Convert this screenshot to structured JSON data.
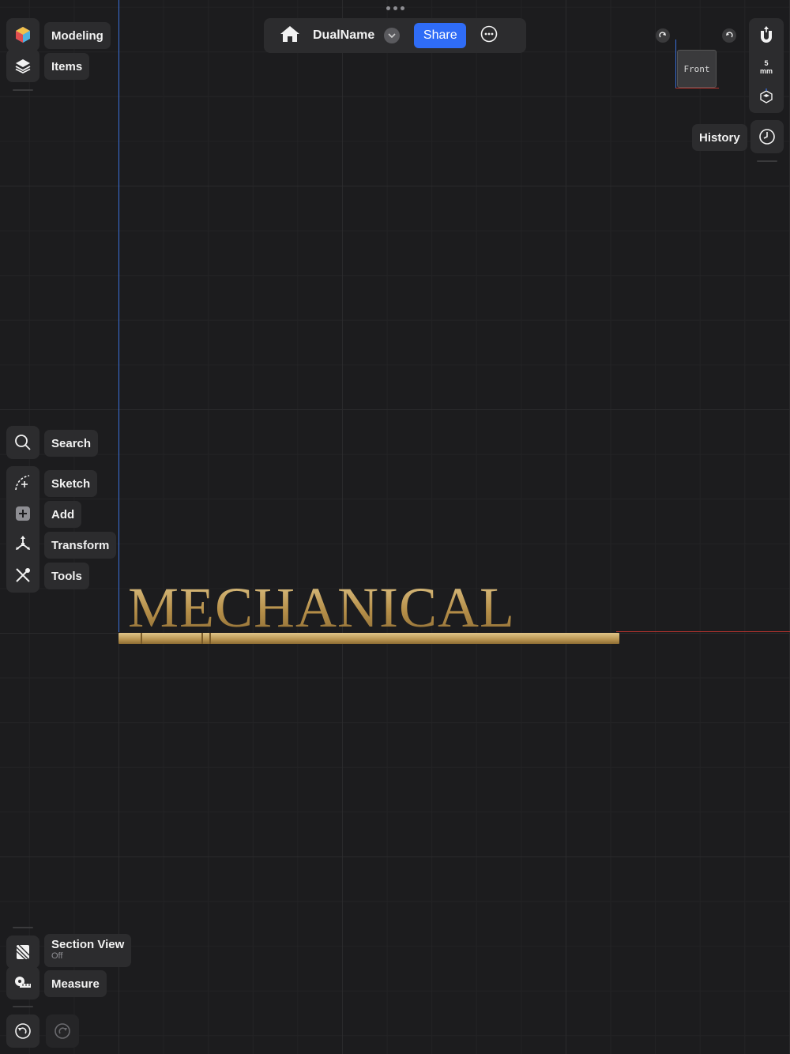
{
  "app": {
    "document_name": "DualName",
    "share_label": "Share"
  },
  "left_top": {
    "modeling_label": "Modeling",
    "items_label": "Items"
  },
  "left_tools": {
    "search_label": "Search",
    "sketch_label": "Sketch",
    "add_label": "Add",
    "transform_label": "Transform",
    "tools_label": "Tools"
  },
  "left_bottom": {
    "section_view_label": "Section View",
    "section_view_state": "Off",
    "measure_label": "Measure"
  },
  "right": {
    "history_label": "History",
    "grid_value": "5",
    "grid_unit": "mm",
    "view_cube_label": "Front"
  },
  "model": {
    "text": "MECHANICAL"
  },
  "colors": {
    "accent": "#2f6cf6",
    "background": "#1c1c1e",
    "panel": "#2c2c2e",
    "x_axis": "#b8342f",
    "z_axis": "#3a6fd8",
    "model_gold": "#c7a765"
  }
}
